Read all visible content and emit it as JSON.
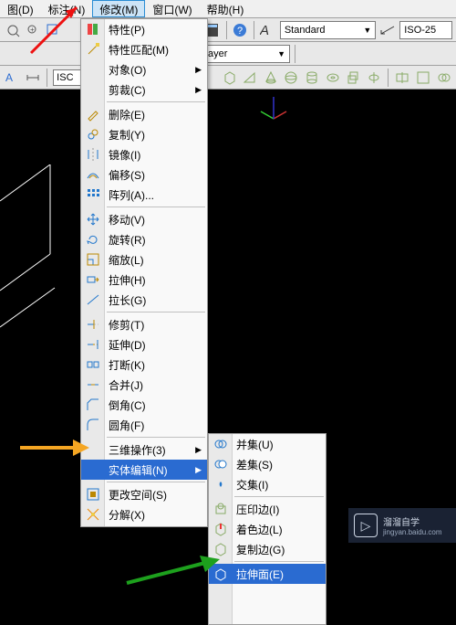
{
  "menubar": {
    "items": [
      {
        "label": "图(D)"
      },
      {
        "label": "标注(N)"
      },
      {
        "label": "修改(M)"
      },
      {
        "label": "窗口(W)"
      },
      {
        "label": "帮助(H)"
      }
    ]
  },
  "style_selector": {
    "value": "Standard"
  },
  "dimstyle_selector": {
    "value": "ISO-25"
  },
  "layer_row": {
    "bylayer_label": "ByLayer"
  },
  "iso_box": {
    "value": "ISC"
  },
  "modify_menu": {
    "groups": [
      [
        {
          "label": "特性(P)",
          "icon": "properties-icon"
        },
        {
          "label": "特性匹配(M)",
          "icon": "matchprop-icon"
        },
        {
          "label": "对象(O)",
          "icon": "",
          "submenu": true
        },
        {
          "label": "剪裁(C)",
          "icon": "",
          "submenu": true
        }
      ],
      [
        {
          "label": "删除(E)",
          "icon": "erase-icon"
        },
        {
          "label": "复制(Y)",
          "icon": "copy-icon"
        },
        {
          "label": "镜像(I)",
          "icon": "mirror-icon"
        },
        {
          "label": "偏移(S)",
          "icon": "offset-icon"
        },
        {
          "label": "阵列(A)...",
          "icon": "array-icon"
        }
      ],
      [
        {
          "label": "移动(V)",
          "icon": "move-icon"
        },
        {
          "label": "旋转(R)",
          "icon": "rotate-icon"
        },
        {
          "label": "缩放(L)",
          "icon": "scale-icon"
        },
        {
          "label": "拉伸(H)",
          "icon": "stretch-icon"
        },
        {
          "label": "拉长(G)",
          "icon": "lengthen-icon"
        }
      ],
      [
        {
          "label": "修剪(T)",
          "icon": "trim-icon"
        },
        {
          "label": "延伸(D)",
          "icon": "extend-icon"
        },
        {
          "label": "打断(K)",
          "icon": "break-icon"
        },
        {
          "label": "合并(J)",
          "icon": "join-icon"
        },
        {
          "label": "倒角(C)",
          "icon": "chamfer-icon"
        },
        {
          "label": "圆角(F)",
          "icon": "fillet-icon"
        }
      ],
      [
        {
          "label": "三维操作(3)",
          "icon": "",
          "submenu": true
        },
        {
          "label": "实体编辑(N)",
          "icon": "",
          "submenu": true,
          "highlight": true
        }
      ],
      [
        {
          "label": "更改空间(S)",
          "icon": "chspace-icon"
        },
        {
          "label": "分解(X)",
          "icon": "explode-icon"
        }
      ]
    ]
  },
  "solidedit_submenu": {
    "groups": [
      [
        {
          "label": "并集(U)",
          "icon": "union-icon"
        },
        {
          "label": "差集(S)",
          "icon": "subtract-icon"
        },
        {
          "label": "交集(I)",
          "icon": "intersect-icon"
        }
      ],
      [
        {
          "label": "压印边(I)",
          "icon": "imprint-icon"
        },
        {
          "label": "着色边(L)",
          "icon": "coloredge-icon"
        },
        {
          "label": "复制边(G)",
          "icon": "copyedge-icon"
        }
      ],
      [
        {
          "label": "拉伸面(E)",
          "icon": "extrudeface-icon",
          "highlight": true
        }
      ]
    ]
  },
  "watermark": {
    "title": "溜溜自学",
    "url": "jingyan.baidu.com",
    "logo_text": "▷"
  }
}
